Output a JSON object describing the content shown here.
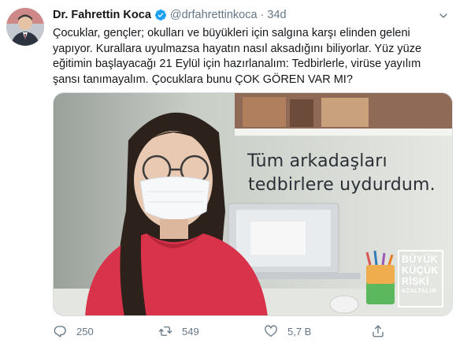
{
  "author": {
    "name": "Dr. Fahrettin Koca",
    "handle": "@drfahrettinkoca",
    "separator": "·",
    "time": "34d",
    "verified": true,
    "avatar_icon": "profile-photo"
  },
  "tweet": {
    "text": "Çocuklar, gençler; okulları ve büyükleri için salgına karşı elinden geleni yapıyor. Kurallara uyulmazsa hayatın nasıl aksadığını biliyorlar. Yüz yüze eğitimin başlayacağı 21 Eylül için hazırlanalım: Tedbirlerle, virüse yayılım şansı tanımayalım. Çocuklara bunu ÇOK GÖREN VAR MI?"
  },
  "media": {
    "caption_line1": "Tüm arkadaşları",
    "caption_line2": "tedbirlere uydurdum.",
    "logo_line1": "BÜYÜK",
    "logo_line2": "KÜÇÜK",
    "logo_line3": "RİSKİ",
    "logo_line4": "AZALTALIM"
  },
  "actions": {
    "reply_count": "250",
    "retweet_count": "549",
    "like_count": "5,7 B"
  },
  "colors": {
    "text": "#14171a",
    "secondary": "#657786",
    "verified": "#1da1f2"
  }
}
